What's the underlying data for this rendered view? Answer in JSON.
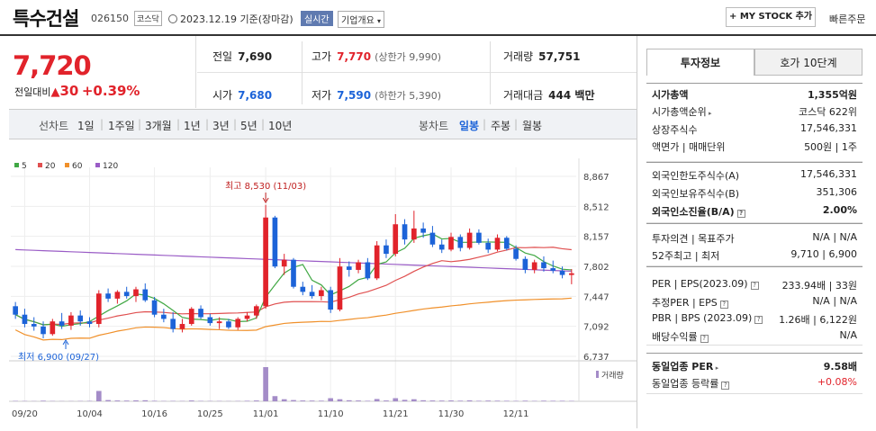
{
  "header": {
    "name": "특수건설",
    "code": "026150",
    "market": "코스닥",
    "date": "2023.12.19",
    "basis": "기준(장마감)",
    "realtime": "실시간",
    "company_info": "기업개요",
    "my_stock": "+ MY STOCK 추가",
    "quick_order": "빠른주문"
  },
  "price": {
    "current": "7,720",
    "change_label": "전일대비",
    "change": "30",
    "change_pct": "+0.39%"
  },
  "stats": {
    "prev_label": "전일",
    "prev": "7,690",
    "high_label": "고가",
    "high": "7,770",
    "upper_limit": "(상한가 9,990)",
    "vol_label": "거래량",
    "volume": "57,751",
    "open_label": "시가",
    "open": "7,680",
    "low_label": "저가",
    "low": "7,590",
    "lower_limit": "(하한가 5,390)",
    "amount_label": "거래대금",
    "amount": "444 백만"
  },
  "periods": {
    "line": "선차트",
    "d1": "1일",
    "w1": "1주일",
    "m3": "3개월",
    "y1": "1년",
    "y3": "3년",
    "y5": "5년",
    "y10": "10년",
    "candle": "봉차트",
    "daily": "일봉",
    "weekly": "주봉",
    "monthly": "월봉"
  },
  "colors": {
    "up": "#e1232b",
    "down": "#1c63d8",
    "ma5": "#41a844",
    "ma20": "#e05050",
    "ma60": "#f0902a",
    "ma120": "#9a5cc6",
    "volume": "#a48cc8"
  },
  "chart_data": {
    "type": "candlestick",
    "legend": [
      "5",
      "20",
      "60",
      "120"
    ],
    "y_ticks": [
      "8,867",
      "8,512",
      "8,157",
      "7,802",
      "7,447",
      "7,092",
      "6,737"
    ],
    "ylim": [
      6737,
      8867
    ],
    "x_ticks": [
      "09/20",
      "10/04",
      "10/16",
      "10/25",
      "11/01",
      "11/10",
      "11/21",
      "11/30",
      "12/11"
    ],
    "annotation_high": "최고 8,530 (11/03)",
    "annotation_low": "최저 6,900 (09/27)",
    "volume_label": "거래량",
    "candles": [
      {
        "o": 7330,
        "h": 7380,
        "l": 7180,
        "c": 7230
      },
      {
        "o": 7230,
        "h": 7300,
        "l": 7080,
        "c": 7120
      },
      {
        "o": 7120,
        "h": 7200,
        "l": 7040,
        "c": 7090
      },
      {
        "o": 7090,
        "h": 7150,
        "l": 6950,
        "c": 7000
      },
      {
        "o": 7000,
        "h": 7180,
        "l": 6980,
        "c": 7150
      },
      {
        "o": 7150,
        "h": 7250,
        "l": 7060,
        "c": 7100
      },
      {
        "o": 7100,
        "h": 7260,
        "l": 7050,
        "c": 7220
      },
      {
        "o": 7220,
        "h": 7280,
        "l": 7100,
        "c": 7150
      },
      {
        "o": 7150,
        "h": 7200,
        "l": 7080,
        "c": 7120
      },
      {
        "o": 7120,
        "h": 7520,
        "l": 7080,
        "c": 7480
      },
      {
        "o": 7480,
        "h": 7540,
        "l": 7380,
        "c": 7420
      },
      {
        "o": 7420,
        "h": 7520,
        "l": 7360,
        "c": 7500
      },
      {
        "o": 7500,
        "h": 7560,
        "l": 7420,
        "c": 7450
      },
      {
        "o": 7450,
        "h": 7560,
        "l": 7380,
        "c": 7530
      },
      {
        "o": 7530,
        "h": 7600,
        "l": 7380,
        "c": 7400
      },
      {
        "o": 7400,
        "h": 7440,
        "l": 7200,
        "c": 7230
      },
      {
        "o": 7230,
        "h": 7300,
        "l": 7140,
        "c": 7180
      },
      {
        "o": 7180,
        "h": 7260,
        "l": 7020,
        "c": 7060
      },
      {
        "o": 7060,
        "h": 7180,
        "l": 7020,
        "c": 7120
      },
      {
        "o": 7120,
        "h": 7320,
        "l": 7100,
        "c": 7300
      },
      {
        "o": 7300,
        "h": 7340,
        "l": 7180,
        "c": 7200
      },
      {
        "o": 7200,
        "h": 7240,
        "l": 7100,
        "c": 7130
      },
      {
        "o": 7130,
        "h": 7200,
        "l": 7060,
        "c": 7150
      },
      {
        "o": 7150,
        "h": 7180,
        "l": 7060,
        "c": 7080
      },
      {
        "o": 7080,
        "h": 7200,
        "l": 7050,
        "c": 7180
      },
      {
        "o": 7180,
        "h": 7260,
        "l": 7150,
        "c": 7220
      },
      {
        "o": 7220,
        "h": 7350,
        "l": 7180,
        "c": 7330
      },
      {
        "o": 7330,
        "h": 8530,
        "l": 7300,
        "c": 8380
      },
      {
        "o": 8380,
        "h": 8400,
        "l": 7780,
        "c": 7800
      },
      {
        "o": 7800,
        "h": 7950,
        "l": 7700,
        "c": 7880
      },
      {
        "o": 7880,
        "h": 7900,
        "l": 7540,
        "c": 7560
      },
      {
        "o": 7560,
        "h": 7620,
        "l": 7460,
        "c": 7500
      },
      {
        "o": 7500,
        "h": 7580,
        "l": 7420,
        "c": 7450
      },
      {
        "o": 7450,
        "h": 7560,
        "l": 7400,
        "c": 7520
      },
      {
        "o": 7520,
        "h": 7560,
        "l": 7250,
        "c": 7290
      },
      {
        "o": 7290,
        "h": 7900,
        "l": 7270,
        "c": 7800
      },
      {
        "o": 7800,
        "h": 7860,
        "l": 7680,
        "c": 7760
      },
      {
        "o": 7760,
        "h": 7880,
        "l": 7720,
        "c": 7850
      },
      {
        "o": 7850,
        "h": 7900,
        "l": 7640,
        "c": 7660
      },
      {
        "o": 7660,
        "h": 8100,
        "l": 7640,
        "c": 8050
      },
      {
        "o": 8050,
        "h": 8120,
        "l": 7900,
        "c": 7950
      },
      {
        "o": 7950,
        "h": 8420,
        "l": 7920,
        "c": 8300
      },
      {
        "o": 8300,
        "h": 8360,
        "l": 8060,
        "c": 8120
      },
      {
        "o": 8120,
        "h": 8460,
        "l": 8080,
        "c": 8250
      },
      {
        "o": 8250,
        "h": 8320,
        "l": 8140,
        "c": 8200
      },
      {
        "o": 8200,
        "h": 8280,
        "l": 8030,
        "c": 8060
      },
      {
        "o": 8060,
        "h": 8120,
        "l": 7960,
        "c": 8000
      },
      {
        "o": 8000,
        "h": 8200,
        "l": 7980,
        "c": 8150
      },
      {
        "o": 8150,
        "h": 8180,
        "l": 7980,
        "c": 8020
      },
      {
        "o": 8020,
        "h": 8250,
        "l": 8000,
        "c": 8200
      },
      {
        "o": 8200,
        "h": 8240,
        "l": 8060,
        "c": 8080
      },
      {
        "o": 8080,
        "h": 8130,
        "l": 7960,
        "c": 8000
      },
      {
        "o": 8000,
        "h": 8180,
        "l": 7980,
        "c": 8140
      },
      {
        "o": 8140,
        "h": 8160,
        "l": 7990,
        "c": 8010
      },
      {
        "o": 8010,
        "h": 8050,
        "l": 7870,
        "c": 7890
      },
      {
        "o": 7890,
        "h": 7920,
        "l": 7720,
        "c": 7760
      },
      {
        "o": 7760,
        "h": 7880,
        "l": 7720,
        "c": 7850
      },
      {
        "o": 7850,
        "h": 7920,
        "l": 7740,
        "c": 7780
      },
      {
        "o": 7780,
        "h": 7870,
        "l": 7720,
        "c": 7750
      },
      {
        "o": 7750,
        "h": 7800,
        "l": 7660,
        "c": 7700
      },
      {
        "o": 7700,
        "h": 7770,
        "l": 7590,
        "c": 7720
      }
    ],
    "volume": [
      4,
      3,
      2,
      6,
      3,
      2,
      2,
      3,
      4,
      100,
      12,
      8,
      7,
      9,
      10,
      5,
      3,
      4,
      3,
      8,
      4,
      3,
      3,
      2,
      3,
      5,
      8,
      330,
      50,
      20,
      12,
      8,
      7,
      6,
      30,
      20,
      10,
      8,
      5,
      22,
      8,
      30,
      14,
      20,
      10,
      8,
      7,
      8,
      6,
      9,
      5,
      7,
      6,
      5,
      4,
      6,
      4,
      6,
      5,
      5,
      4
    ]
  },
  "side": {
    "tab1": "투자정보",
    "tab2": "호가 10단계",
    "mcap_label": "시가총액",
    "mcap": "1,355억원",
    "rank_label": "시가총액순위",
    "rank": "코스닥 622위",
    "shares_label": "상장주식수",
    "shares": "17,546,331",
    "face_label": "액면가 | 매매단위",
    "face": "500원 | 1주",
    "foreign_limit_label": "외국인한도주식수(A)",
    "foreign_limit": "17,546,331",
    "foreign_hold_label": "외국인보유주식수(B)",
    "foreign_hold": "351,306",
    "foreign_ratio_label": "외국인소진율(B/A)",
    "foreign_ratio": "2.00%",
    "opinion_label": "투자의견 | 목표주가",
    "opinion": "N/A | N/A",
    "w52_label": "52주최고 | 최저",
    "w52": "9,710 | 6,900",
    "per_label": "PER | EPS(2023.09)",
    "per": "233.94배 | 33원",
    "eper_label": "추정PER | EPS",
    "eper": "N/A | N/A",
    "pbr_label": "PBR | BPS (2023.09)",
    "pbr": "1.26배 | 6,122원",
    "div_label": "배당수익률",
    "div": "N/A",
    "ind_per_label": "동일업종 PER",
    "ind_per": "9.58배",
    "ind_rate_label": "동일업종 등락률",
    "ind_rate": "+0.08%"
  }
}
